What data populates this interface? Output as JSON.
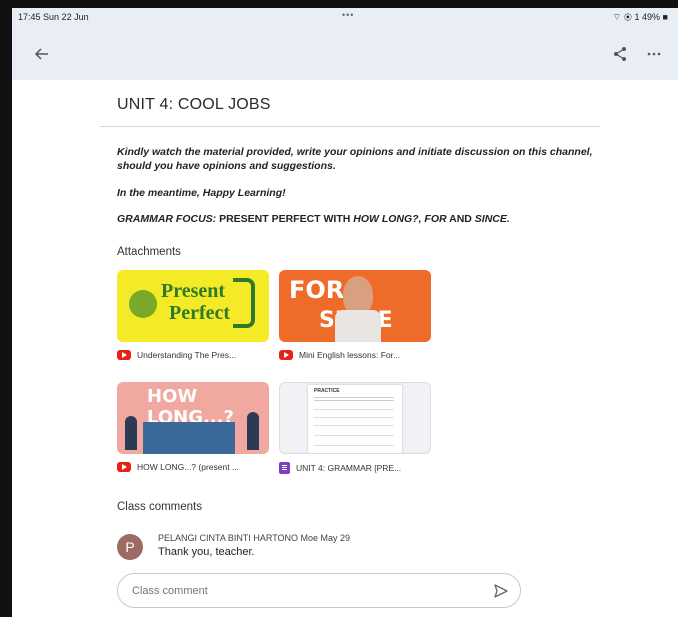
{
  "status_bar": {
    "time": "17:45",
    "date": "Sun 22 Jun",
    "dots": "•••",
    "right": "⌔ ◉ 1 49% ■"
  },
  "header": {
    "title": "UNIT 4: COOL JOBS"
  },
  "post": {
    "p1": "Kindly watch the material provided, write your opinions and initiate discussion on this channel, should you have opinions and suggestions.",
    "p2": "In the meantime, Happy Learning!",
    "p3_parts": [
      "GRAMMAR FOCUS: ",
      "PRESENT PERFECT  WITH ",
      "HOW LONG?, FOR",
      " AND ",
      "SINCE."
    ]
  },
  "attachments": {
    "heading": "Attachments",
    "items": [
      {
        "title": "Understanding The Pres...",
        "thumb_line1": "Present",
        "thumb_line2": "Perfect",
        "icon": "youtube-icon"
      },
      {
        "title": "Mini English lessons: For...",
        "thumb_line1": "FOR &",
        "thumb_line2": "SINCE",
        "icon": "youtube-icon"
      },
      {
        "title": "HOW LONG...? (present ...",
        "thumb_line1": "HOW LONG...?",
        "icon": "youtube-icon"
      },
      {
        "title": "UNIT 4: GRAMMAR [PRE...",
        "thumb_line1": "PRACTICE",
        "icon": "document-icon"
      }
    ]
  },
  "class_comments": {
    "heading": "Class comments",
    "items": [
      {
        "avatar": "P",
        "author": "PELANGI CINTA BINTI HARTONO Moe May 29",
        "text": "Thank you, teacher."
      }
    ]
  },
  "comment_input": {
    "placeholder": "Class comment"
  },
  "colors": {
    "appbar": "#e9edf6",
    "youtube": "#e62117",
    "doc": "#7b3fc4",
    "avatar": "#9c6b63"
  }
}
